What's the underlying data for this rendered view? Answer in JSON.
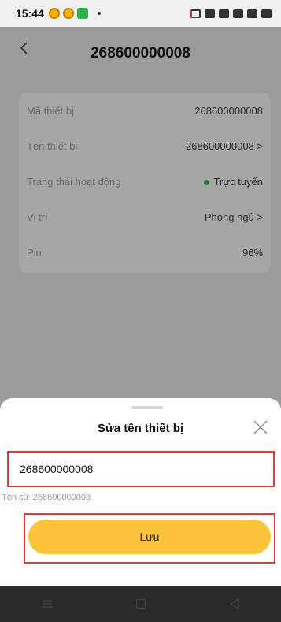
{
  "status_bar": {
    "time": "15:44"
  },
  "header": {
    "back_icon": "chevron-left-icon",
    "title": "268600000008"
  },
  "info": {
    "rows": [
      {
        "label": "Mã thiết bị",
        "value": "268600000008"
      },
      {
        "label": "Tên thiết bị",
        "value": "268600000008 >"
      },
      {
        "label": "Trạng thái hoạt động",
        "value": "Trực tuyến",
        "status_color": "#1a7a36"
      },
      {
        "label": "Vị trí",
        "value": "Phòng ngủ >"
      },
      {
        "label": "Pin",
        "value": "96%"
      }
    ]
  },
  "dialog": {
    "title": "Sửa tên thiết bị",
    "close_icon": "close-icon",
    "input_value": "268600000008",
    "old_name": "Tên cũ: 268600000008",
    "save_label": "Lưu",
    "accent_color": "#fcc33b",
    "highlight_color": "#e53935"
  },
  "nav": {
    "icons": [
      "menu-icon",
      "home-square-icon",
      "back-triangle-icon"
    ]
  }
}
